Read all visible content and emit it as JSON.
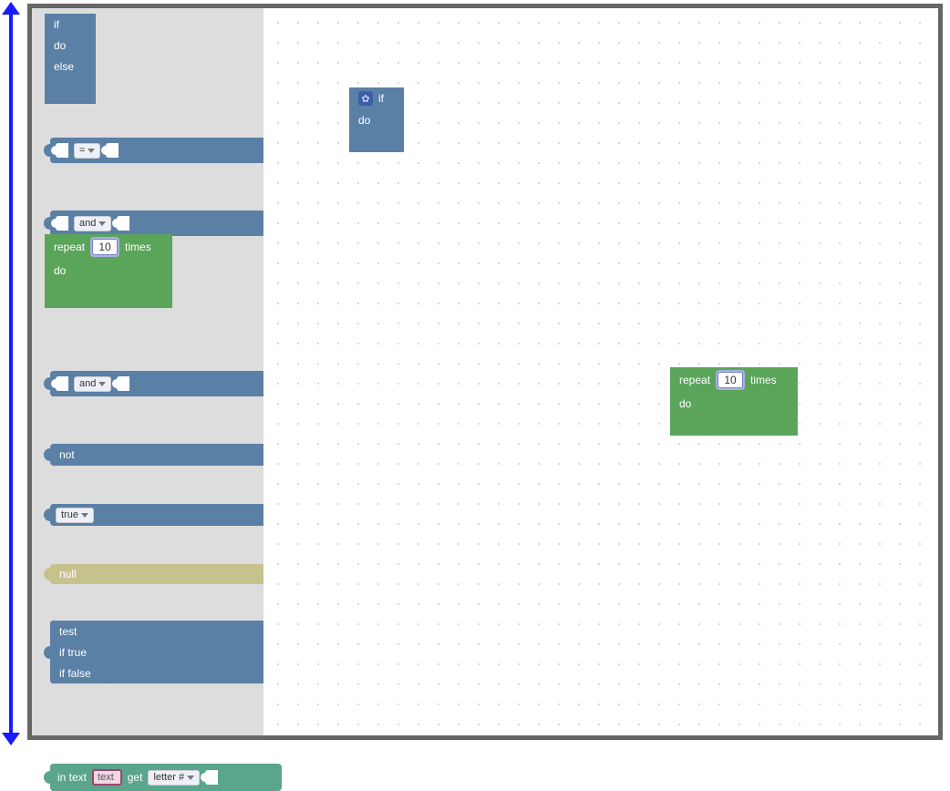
{
  "colors": {
    "logic": "#5b80a5",
    "loops": "#5ba55b",
    "null": "#c6c28d",
    "text": "#5ba58c",
    "arrow": "#1a1aff"
  },
  "toolbox": {
    "if_do_else": {
      "if": "if",
      "do": "do",
      "else": "else"
    },
    "compare": {
      "op": "="
    },
    "and1": {
      "op": "and"
    },
    "repeat": {
      "repeat": "repeat",
      "count": "10",
      "times": "times",
      "do": "do"
    },
    "and2": {
      "op": "and"
    },
    "not": {
      "label": "not"
    },
    "true": {
      "label": "true"
    },
    "null": {
      "label": "null"
    },
    "testblock": {
      "test": "test",
      "if_true": "if true",
      "if_false": "if false"
    },
    "intext": {
      "in_text": "in text",
      "field": "text",
      "get": "get",
      "mode": "letter #"
    }
  },
  "workspace": {
    "if_block": {
      "if": "if",
      "do": "do"
    },
    "repeat_block": {
      "repeat": "repeat",
      "count": "10",
      "times": "times",
      "do": "do"
    }
  }
}
